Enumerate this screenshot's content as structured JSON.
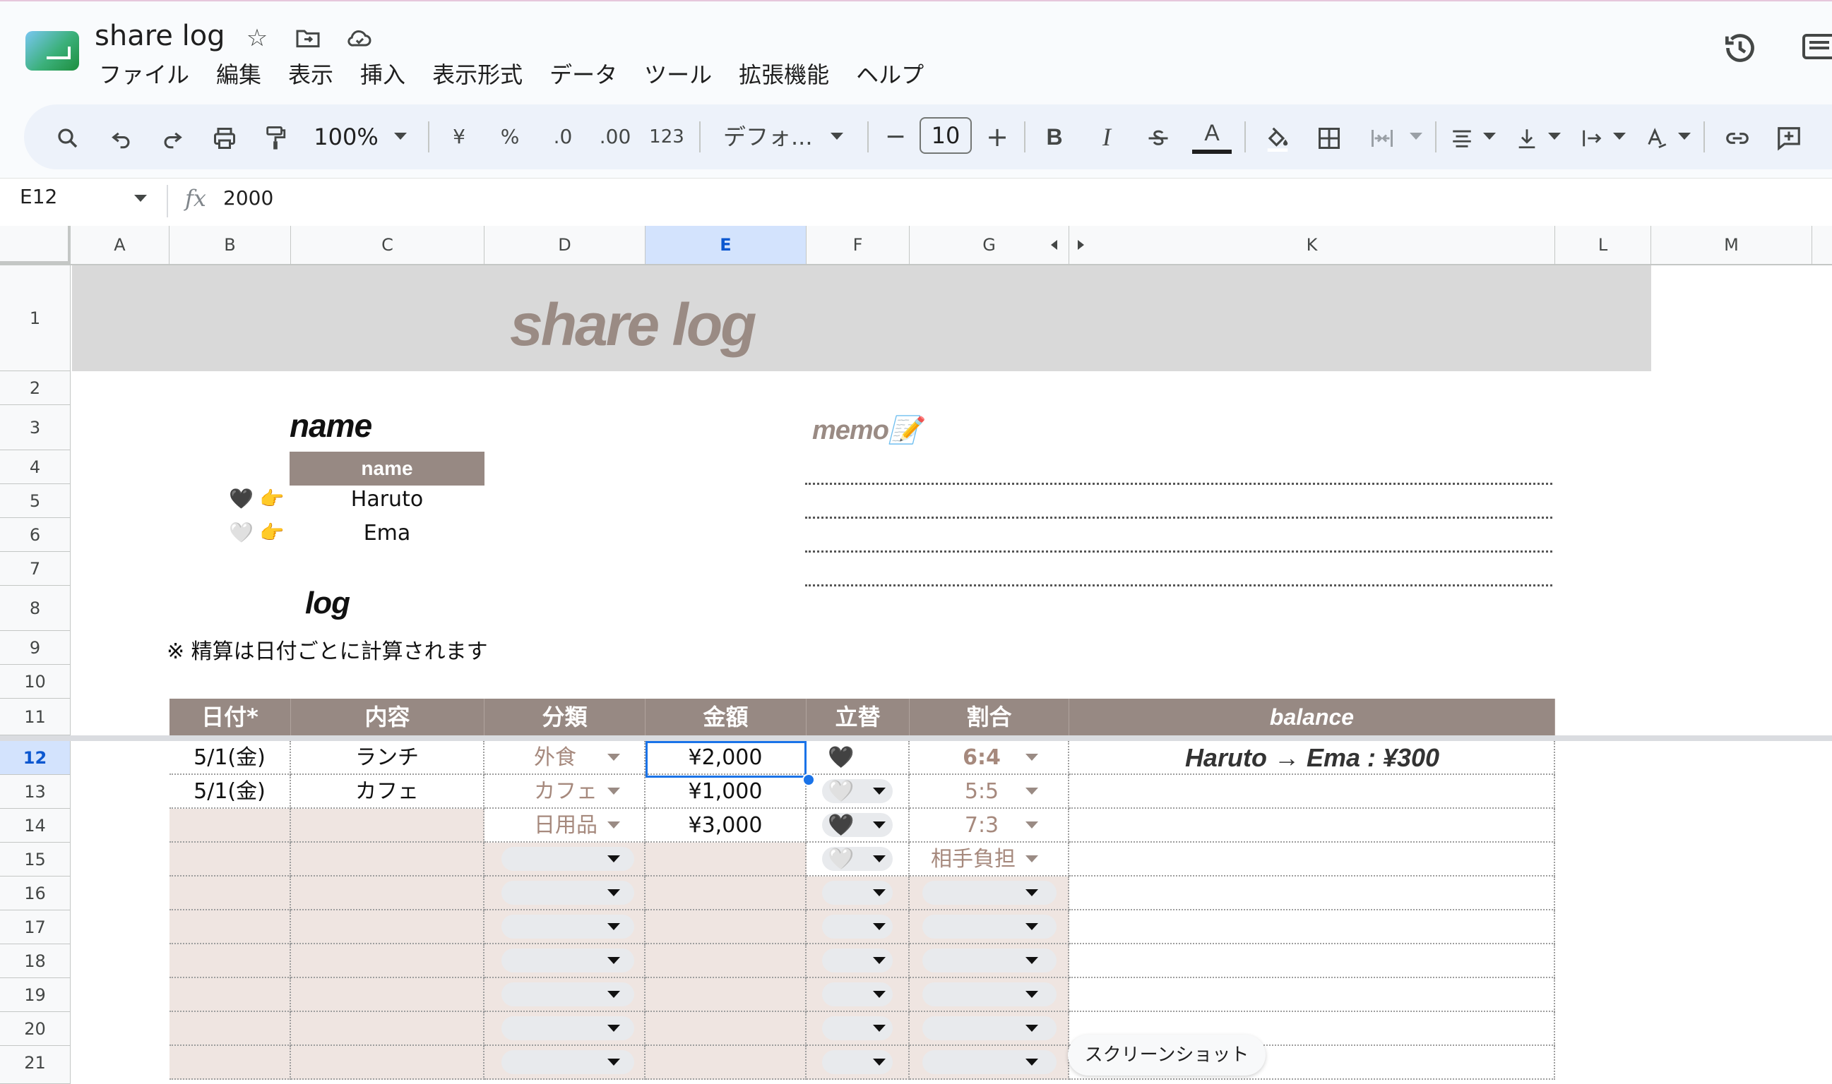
{
  "app": {
    "title": "share log",
    "menu": [
      "ファイル",
      "編集",
      "表示",
      "挿入",
      "表示形式",
      "データ",
      "ツール",
      "拡張機能",
      "ヘルプ"
    ]
  },
  "toolbar": {
    "zoom": "100%",
    "currency": "¥",
    "percent": "%",
    "decrease_decimal": ".0",
    "increase_decimal": ".00",
    "number_format": "123",
    "font": "デフォ...",
    "font_size": "10",
    "minus": "−",
    "plus": "+",
    "bold": "B",
    "italic": "I",
    "text_color": "A"
  },
  "formula_bar": {
    "cell_ref": "E12",
    "fx": "fx",
    "value": "2000"
  },
  "columns": [
    "A",
    "B",
    "C",
    "D",
    "E",
    "F",
    "G",
    "K",
    "L",
    "M"
  ],
  "selected_column": "E",
  "rows": [
    "1",
    "2",
    "3",
    "4",
    "5",
    "6",
    "7",
    "8",
    "9",
    "10",
    "11",
    "12",
    "13",
    "14",
    "15",
    "16",
    "17",
    "18",
    "19",
    "20",
    "21"
  ],
  "selected_row": "12",
  "sheet": {
    "banner_title": "share log",
    "name_heading": "name",
    "name_table_header": "name",
    "names": [
      {
        "marker": "🖤 👉",
        "name": "Haruto"
      },
      {
        "marker": "🤍 👉",
        "name": "Ema"
      }
    ],
    "memo_heading": "memo📝",
    "log_heading": "log",
    "log_note": "※ 精算は日付ごとに計算されます",
    "log_headers": [
      "日付*",
      "内容",
      "分類",
      "金額",
      "立替",
      "割合",
      "balance"
    ],
    "log_rows": [
      {
        "date": "5/1(金)",
        "content": "ランチ",
        "category": "外食",
        "amount": "¥2,000",
        "payer": "🖤",
        "ratio": "6:4",
        "balance": "Haruto → Ema : ¥300"
      },
      {
        "date": "5/1(金)",
        "content": "カフェ",
        "category": "カフェ",
        "amount": "¥1,000",
        "payer": "🤍",
        "ratio": "5:5",
        "balance": ""
      },
      {
        "date": "",
        "content": "",
        "category": "日用品",
        "amount": "¥3,000",
        "payer": "🖤",
        "ratio": "7:3",
        "balance": ""
      },
      {
        "date": "",
        "content": "",
        "category": "",
        "amount": "",
        "payer": "🤍",
        "ratio": "相手負担",
        "balance": ""
      },
      {
        "date": "",
        "content": "",
        "category": "",
        "amount": "",
        "payer": "",
        "ratio": "",
        "balance": ""
      },
      {
        "date": "",
        "content": "",
        "category": "",
        "amount": "",
        "payer": "",
        "ratio": "",
        "balance": ""
      },
      {
        "date": "",
        "content": "",
        "category": "",
        "amount": "",
        "payer": "",
        "ratio": "",
        "balance": ""
      },
      {
        "date": "",
        "content": "",
        "category": "",
        "amount": "",
        "payer": "",
        "ratio": "",
        "balance": ""
      },
      {
        "date": "",
        "content": "",
        "category": "",
        "amount": "",
        "payer": "",
        "ratio": "",
        "balance": ""
      },
      {
        "date": "",
        "content": "",
        "category": "",
        "amount": "",
        "payer": "",
        "ratio": "",
        "balance": ""
      }
    ]
  },
  "tooltip": "スクリーンショット",
  "colors": {
    "header_fill": "#978983",
    "banner_fill": "#d9d9d9",
    "empty_cell_fill": "#efe5e1",
    "accent_text": "#a6897d",
    "selection_blue": "#1a73e8"
  }
}
